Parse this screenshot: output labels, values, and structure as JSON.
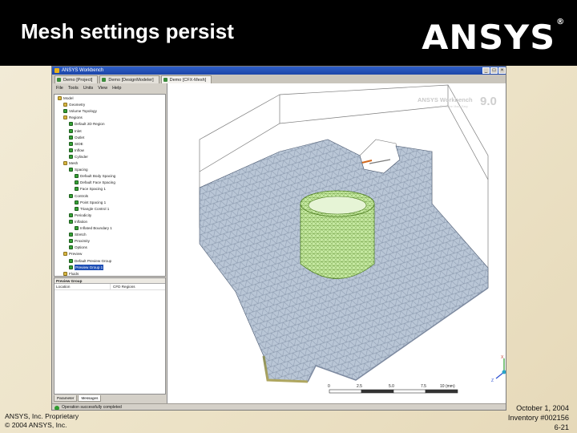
{
  "slide": {
    "title": "Mesh settings persist",
    "logo": "ANSYS",
    "footer_left": [
      "ANSYS, Inc. Proprietary",
      "© 2004 ANSYS, Inc."
    ],
    "footer_right": [
      "October 1, 2004",
      "Inventory #002156",
      "6-21"
    ]
  },
  "window": {
    "title": "ANSYS Workbench",
    "tabs": [
      {
        "label": "Demo [Project]",
        "active": false
      },
      {
        "label": "Demo [DesignModeler]",
        "active": false
      },
      {
        "label": "Demo [CFX-Mesh]",
        "active": true
      }
    ],
    "menu": [
      "File",
      "Tools",
      "Units",
      "View",
      "Help"
    ],
    "statusbar": "Operation successfully completed"
  },
  "tree": {
    "items": [
      {
        "label": "Model",
        "depth": 0,
        "icon": "folder"
      },
      {
        "label": "Geometry",
        "depth": 1,
        "icon": "folder"
      },
      {
        "label": "Volume Topology",
        "depth": 1,
        "icon": "node"
      },
      {
        "label": "Regions",
        "depth": 1,
        "icon": "folder"
      },
      {
        "label": "Default 2D Region",
        "depth": 2,
        "icon": "node"
      },
      {
        "label": "Inlet",
        "depth": 2,
        "icon": "node"
      },
      {
        "label": "Outlet",
        "depth": 2,
        "icon": "node"
      },
      {
        "label": "SIDE",
        "depth": 2,
        "icon": "node"
      },
      {
        "label": "Inflow",
        "depth": 2,
        "icon": "node"
      },
      {
        "label": "Cylinder",
        "depth": 2,
        "icon": "node"
      },
      {
        "label": "Mesh",
        "depth": 1,
        "icon": "folder"
      },
      {
        "label": "Spacing",
        "depth": 2,
        "icon": "node"
      },
      {
        "label": "Default Body Spacing",
        "depth": 3,
        "icon": "node"
      },
      {
        "label": "Default Face Spacing",
        "depth": 3,
        "icon": "node"
      },
      {
        "label": "Face Spacing 1",
        "depth": 3,
        "icon": "node"
      },
      {
        "label": "Controls",
        "depth": 2,
        "icon": "node"
      },
      {
        "label": "Point Spacing 1",
        "depth": 3,
        "icon": "node"
      },
      {
        "label": "Triangle Control 1",
        "depth": 3,
        "icon": "node"
      },
      {
        "label": "Periodicity",
        "depth": 2,
        "icon": "node"
      },
      {
        "label": "Inflation",
        "depth": 2,
        "icon": "node"
      },
      {
        "label": "Inflated Boundary 1",
        "depth": 3,
        "icon": "node"
      },
      {
        "label": "Stretch",
        "depth": 2,
        "icon": "node"
      },
      {
        "label": "Proximity",
        "depth": 2,
        "icon": "node"
      },
      {
        "label": "Options",
        "depth": 2,
        "icon": "node"
      },
      {
        "label": "Preview",
        "depth": 1,
        "icon": "folder"
      },
      {
        "label": "Default Preview Group",
        "depth": 2,
        "icon": "node"
      },
      {
        "label": "Preview Group 1",
        "depth": 2,
        "icon": "node",
        "selected": true
      },
      {
        "label": "Fluids",
        "depth": 1,
        "icon": "folder"
      }
    ]
  },
  "details": {
    "header": "Preview Group",
    "rows": [
      {
        "k": "Location",
        "v": "CFD Regions"
      }
    ],
    "tabs": [
      {
        "label": "Parameter",
        "active": false
      },
      {
        "label": "Messages",
        "active": true
      }
    ]
  },
  "viewport": {
    "watermark": "ANSYS Workbench",
    "version": "9.0",
    "subtitle": "Simulation Made Easy",
    "scale_labels": [
      "0",
      "2.5",
      "5.0",
      "7.5",
      "10 (mm)"
    ],
    "axis_labels": [
      "X",
      "Y",
      "Z"
    ],
    "colors": {
      "mesh_fill": "#b9c6d6",
      "mesh_line": "#5f6e86",
      "cylinder": "#bfe59a",
      "cylinder_line": "#5a8a2d",
      "box": "#7c7c7c"
    }
  }
}
